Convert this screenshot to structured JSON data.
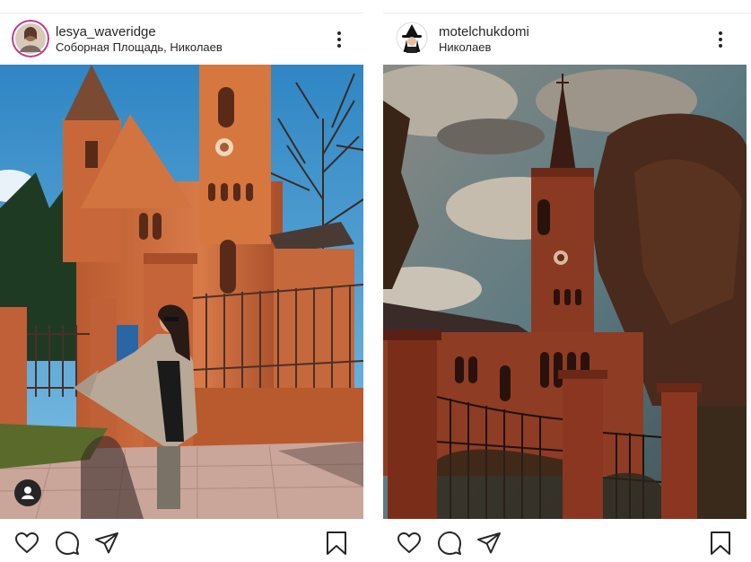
{
  "posts": [
    {
      "username": "lesya_waveridge",
      "location": "Соборная Площадь, Николаев",
      "avatar_icon": "profile-avatar",
      "photo_icon": "church-photo-sunny",
      "tagged_user_icon": "user-tag-icon"
    },
    {
      "username": "motelchukdomi",
      "location": "Николаев",
      "avatar_icon": "profile-avatar-witch",
      "photo_icon": "church-photo-moody"
    }
  ],
  "actions": {
    "like_icon": "heart-icon",
    "comment_icon": "comment-icon",
    "share_icon": "paper-plane-icon",
    "save_icon": "bookmark-icon",
    "more_icon": "more-vertical-icon"
  },
  "colors": {
    "text": "#262626",
    "brick_sunny": "#c8683a",
    "sky_sunny": "#3f9ad0",
    "brick_moody": "#8a3e26",
    "sky_moody": "#6f7a78"
  }
}
